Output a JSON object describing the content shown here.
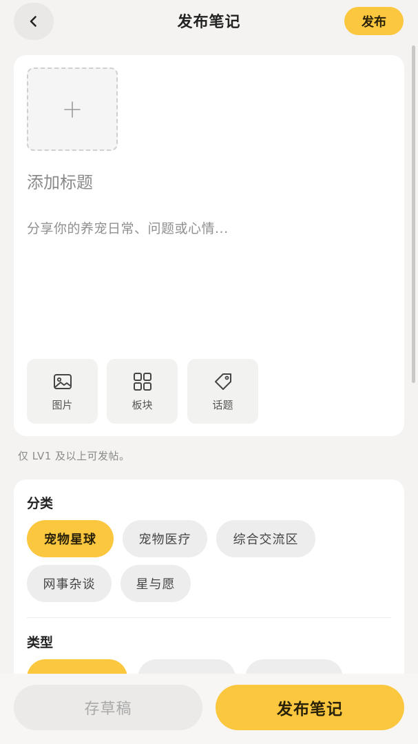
{
  "header": {
    "title": "发布笔记",
    "publish_label": "发布",
    "back_icon": "chevron-left-icon"
  },
  "editor": {
    "image_slot_icon": "plus-icon",
    "title_placeholder": "添加标题",
    "content_placeholder": "分享你的养宠日常、问题或心情...",
    "tools": [
      {
        "label": "图片",
        "icon": "image-icon"
      },
      {
        "label": "板块",
        "icon": "grid-icon"
      },
      {
        "label": "话题",
        "icon": "tag-icon"
      }
    ]
  },
  "level_note": "仅 LV1 及以上可发帖。",
  "options": {
    "category_label": "分类",
    "categories": [
      {
        "label": "宠物星球",
        "selected": true
      },
      {
        "label": "宠物医疗",
        "selected": false
      },
      {
        "label": "综合交流区",
        "selected": false
      },
      {
        "label": "网事杂谈",
        "selected": false
      },
      {
        "label": "星与愿",
        "selected": false
      }
    ],
    "type_label": "类型"
  },
  "bottom": {
    "draft_label": "存草稿",
    "submit_label": "发布笔记"
  },
  "colors": {
    "accent": "#fbc73f",
    "background": "#f4f3f1",
    "card": "#ffffff",
    "chip": "#ededed"
  }
}
